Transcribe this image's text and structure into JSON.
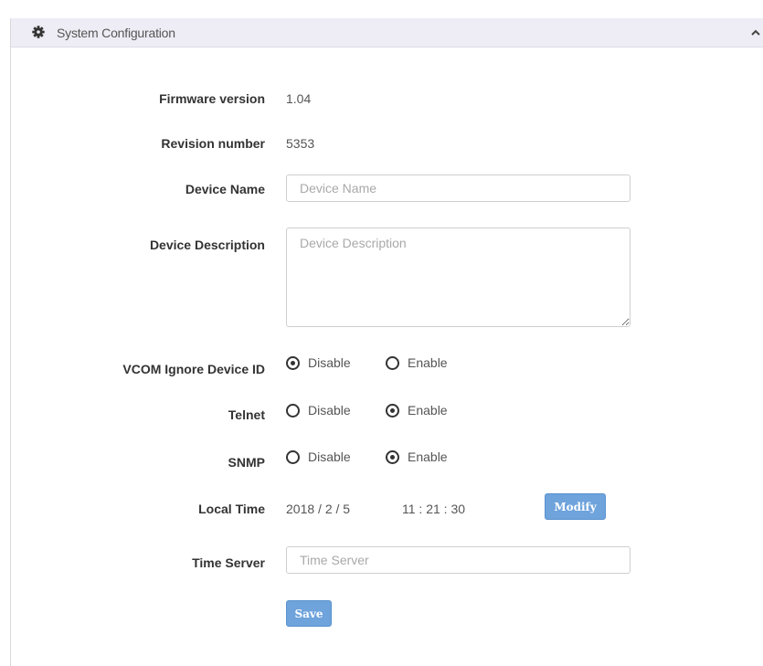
{
  "panel": {
    "title": "System Configuration",
    "header_icon": "gear-icon",
    "collapse_icon": "chevron-up-icon"
  },
  "firmware": {
    "label": "Firmware version",
    "value": "1.04"
  },
  "revision": {
    "label": "Revision number",
    "value": "5353"
  },
  "device_name": {
    "label": "Device Name",
    "value": "",
    "placeholder": "Device Name"
  },
  "device_description": {
    "label": "Device Description",
    "value": "",
    "placeholder": "Device Description"
  },
  "vcom_ignore": {
    "label": "VCOM Ignore Device ID",
    "options": [
      "Disable",
      "Enable"
    ],
    "selected": "Disable"
  },
  "telnet": {
    "label": "Telnet",
    "options": [
      "Disable",
      "Enable"
    ],
    "selected": "Enable"
  },
  "snmp": {
    "label": "SNMP",
    "options": [
      "Disable",
      "Enable"
    ],
    "selected": "Enable"
  },
  "local_time": {
    "label": "Local Time",
    "date": "2018 / 2 / 5",
    "time": "11 : 21 : 30",
    "modify_label": "Modify"
  },
  "time_server": {
    "label": "Time Server",
    "value": "",
    "placeholder": "Time Server"
  },
  "save_label": "Save",
  "colors": {
    "button": "#6ea3dc",
    "header_bg": "#eeedf5"
  }
}
